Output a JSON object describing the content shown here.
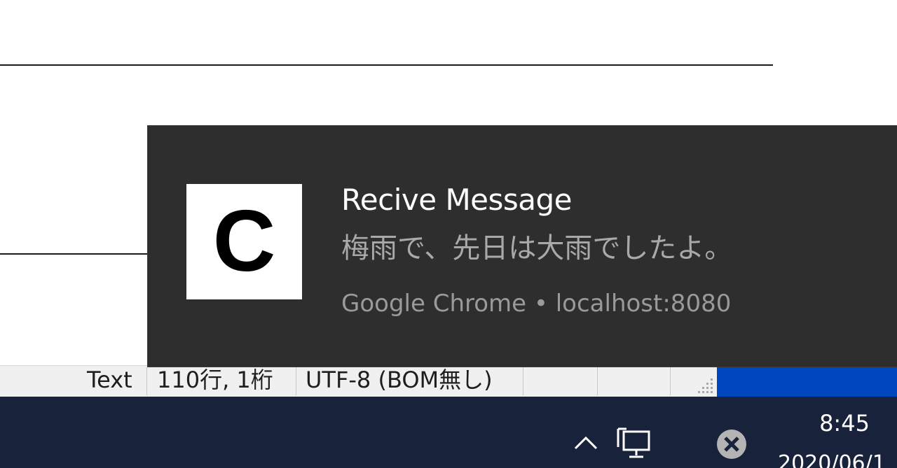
{
  "notification": {
    "app_icon_letter": "C",
    "title": "Recive Message",
    "body": "梅雨で、先日は大雨でしたよ。",
    "source": "Google Chrome • localhost:8080"
  },
  "statusbar": {
    "mode": "Text",
    "position": "110行, 1桁",
    "encoding": "UTF-8 (BOM無し)"
  },
  "taskbar": {
    "tray_icons": [
      "chevron-up-icon",
      "network-icon",
      "close-circle-icon"
    ],
    "clock_time": "8:45",
    "clock_date": "2020/06/1"
  },
  "colors": {
    "toast_background": "#2e2e2e",
    "taskbar_background": "#18223a",
    "statusbar_accent": "#0046bd"
  }
}
